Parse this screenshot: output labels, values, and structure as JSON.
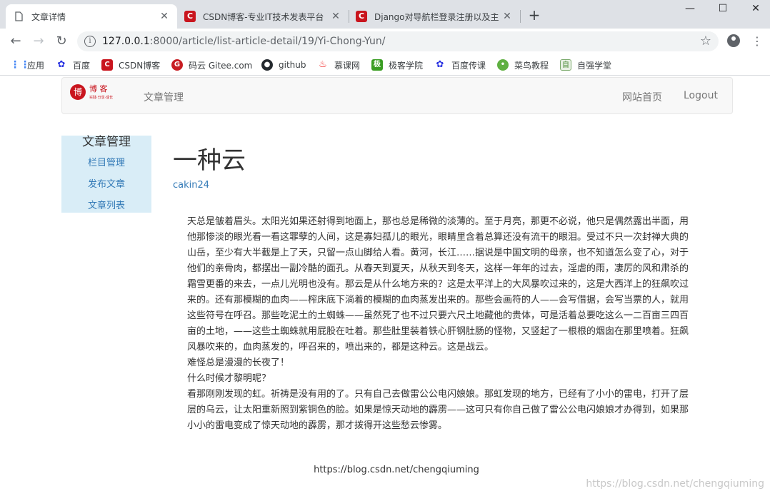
{
  "browser": {
    "tabs": [
      {
        "title": "文章详情",
        "active": true
      },
      {
        "title": "CSDN博客-专业IT技术发表平台",
        "active": false
      },
      {
        "title": "Django对导航栏登录注册以及主",
        "active": false
      }
    ],
    "close_glyph": "✕",
    "new_tab_glyph": "+",
    "window_controls": {
      "minimize": "—",
      "maximize": "☐",
      "close": "✕"
    },
    "url": {
      "host": "127.0.0.1",
      "path": ":8000/article/list-article-detail/19/Yi-Chong-Yun/"
    },
    "bookmarks": [
      {
        "label": "应用",
        "icon": "apps-grid-icon",
        "color": "#4285f4"
      },
      {
        "label": "百度",
        "icon": "baidu-paw-icon",
        "color": "#2932e1"
      },
      {
        "label": "CSDN博客",
        "icon": "csdn-icon",
        "color": "#c9151e"
      },
      {
        "label": "码云 Gitee.com",
        "icon": "gitee-icon",
        "color": "#c71d23"
      },
      {
        "label": "github",
        "icon": "github-icon",
        "color": "#24292e"
      },
      {
        "label": "慕课网",
        "icon": "imooc-flame-icon",
        "color": "#f01414"
      },
      {
        "label": "极客学院",
        "icon": "jike-icon",
        "color": "#3a9d23"
      },
      {
        "label": "百度传课",
        "icon": "baidu-paw-icon",
        "color": "#2932e1"
      },
      {
        "label": "菜鸟教程",
        "icon": "runoob-icon",
        "color": "#5fb041"
      },
      {
        "label": "自强学堂",
        "icon": "ziqiang-icon",
        "color": "#7aa96b"
      }
    ]
  },
  "navbar": {
    "logo_text": "博 客",
    "logo_sub": "实践·分享·成长",
    "manage_link": "文章管理",
    "home_link": "网站首页",
    "logout_link": "Logout"
  },
  "sidebar": {
    "heading": "文章管理",
    "items": [
      "栏目管理",
      "发布文章",
      "文章列表"
    ]
  },
  "article": {
    "title": "一种云",
    "author": "cakin24",
    "paragraphs": [
      "天总是皱着眉头。太阳光如果还射得到地面上，那也总是稀微的淡薄的。至于月亮，那更不必说，他只是偶然露出半面，用他那惨淡的眼光看一看这罪孽的人间，这是寡妇孤儿的眼光，眼睛里含着总算还没有流干的眼泪。受过不只一次封禅大典的山岳，至少有大半截是上了天，只留一点山脚给人看。黄河，长江……据说是中国文明的母亲，也不知道怎么变了心，对于他们的亲骨肉，都摆出一副冷酷的面孔。从春天到夏天，从秋天到冬天，这样一年年的过去，淫虐的雨，凄厉的风和肃杀的霜雪更番的来去，一点儿光明也没有。那云是从什么地方来的？这是太平洋上的大风暴吹过来的，这是大西洋上的狂飙吹过来的。还有那模糊的血肉——榨床底下淌着的模糊的血肉蒸发出来的。那些会画符的人——会写借据，会写当票的人，就用这些符号在呼召。那些吃泥土的土蜘蛛——虽然死了也不过只要六尺土地藏他的贵体，可是活着总要吃这么一二百亩三四百亩的土地，——这些土蜘蛛就用屁股在吐着。那些肚里装着铁心肝钢肚肠的怪物，又竖起了一根根的烟囱在那里喷着。狂飙风暴吹来的，血肉蒸发的，呼召来的，喷出来的，都是这种云。这是战云。",
      "难怪总是漫漫的长夜了！",
      "什么时候才黎明呢？",
      "看那刚刚发现的虹。祈祷是没有用的了。只有自己去做雷公公电闪娘娘。那虹发现的地方，已经有了小小的雷电，打开了层层的乌云，让太阳重新照到紫铜色的脸。如果是惊天动地的霹雳——这可只有你自己做了雷公公电闪娘娘才办得到，如果那小小的雷电变成了惊天动地的霹雳，那才拨得开这些愁云惨雾。"
    ]
  },
  "footer": {
    "url_text": "https://blog.csdn.net/chengqiuming",
    "watermark": "https://blog.csdn.net/chengqiuming"
  }
}
